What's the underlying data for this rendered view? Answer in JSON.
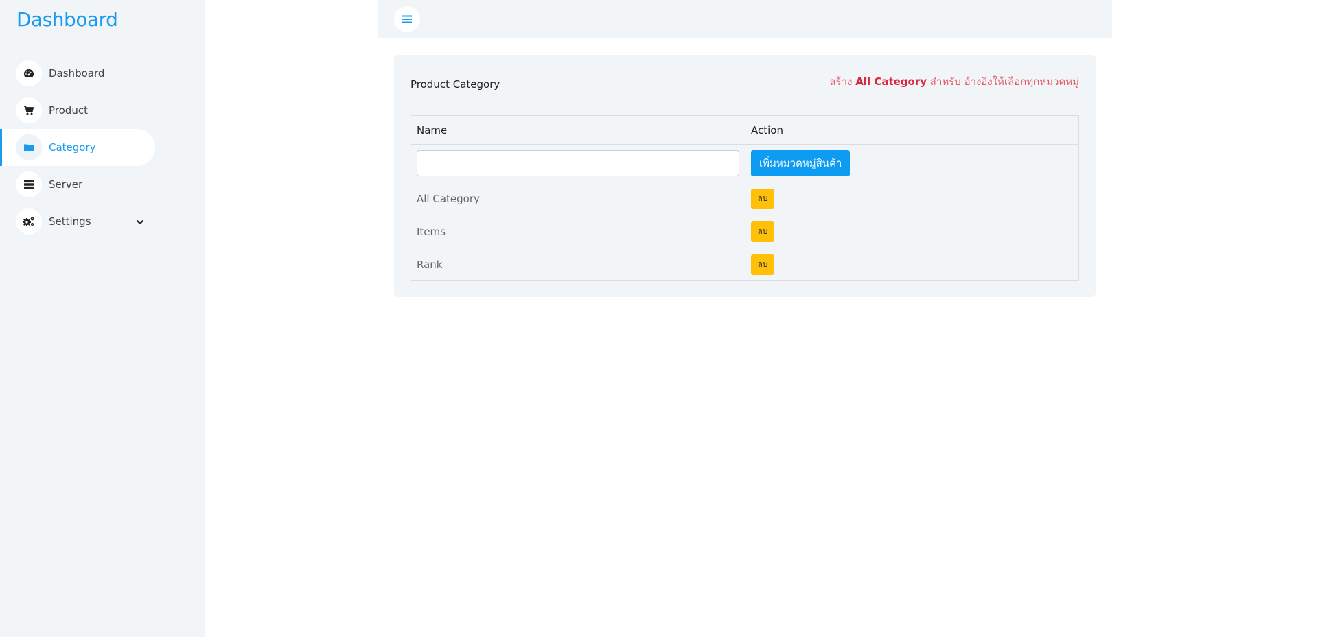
{
  "sidebar": {
    "brand": "Dashboard",
    "items": [
      {
        "label": "Dashboard",
        "icon": "gauge-icon"
      },
      {
        "label": "Product",
        "icon": "cart-icon"
      },
      {
        "label": "Category",
        "icon": "folder-icon",
        "active": true
      },
      {
        "label": "Server",
        "icon": "server-icon"
      },
      {
        "label": "Settings",
        "icon": "gears-icon"
      }
    ]
  },
  "card": {
    "title": "Product Category",
    "note_prefix": "สร้าง ",
    "note_highlight": "All Category",
    "note_suffix": " สำหรับ อ้างอิงให้เลือกทุกหมวดหมู่",
    "columns": [
      "Name",
      "Action"
    ],
    "input_value": "",
    "add_label": "เพิ่มหมวดหมู่สินค้า",
    "delete_label": "ลบ",
    "rows": [
      "All Category",
      "Items",
      "Rank"
    ]
  },
  "colors": {
    "accent": "#1a9bf0",
    "delete": "#ffc107",
    "note": "#e35d6a"
  }
}
